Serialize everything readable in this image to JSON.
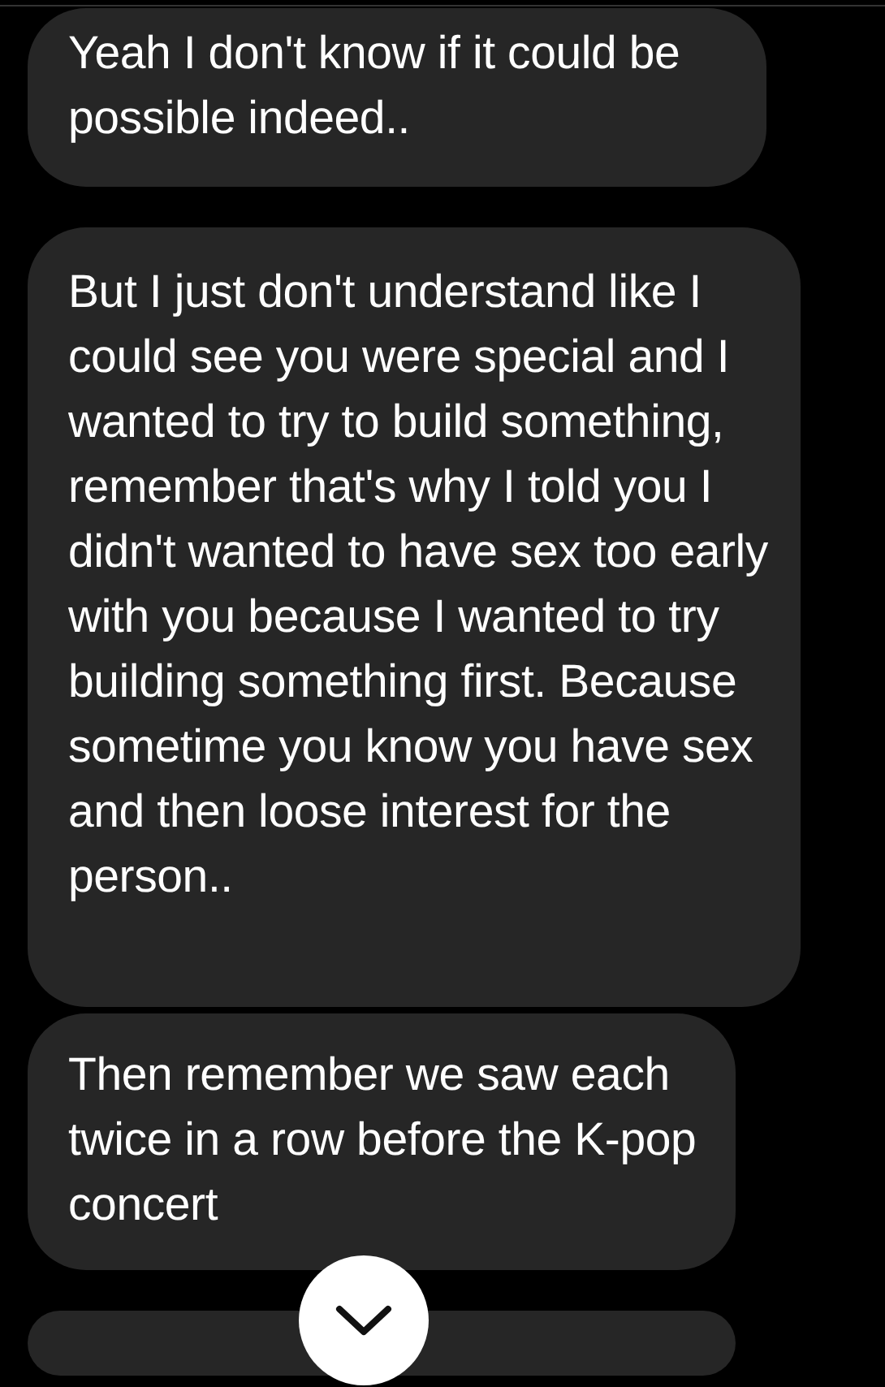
{
  "messages": [
    {
      "kind": "text",
      "text": "Yeah I don't know if it could be possible indeed.."
    },
    {
      "kind": "text",
      "text": "But I just don't understand like I could see you were special and I wanted to try to build something, remember that's why I told you I didn't wanted to have sex too early with you because I wanted to try building something first. Because sometime you know you have sex and then loose interest for the person.."
    },
    {
      "kind": "text",
      "text": "Then remember we saw each twice in a row before the K-pop concert"
    },
    {
      "kind": "partial"
    }
  ],
  "scroll_button": {
    "kind": "down"
  }
}
